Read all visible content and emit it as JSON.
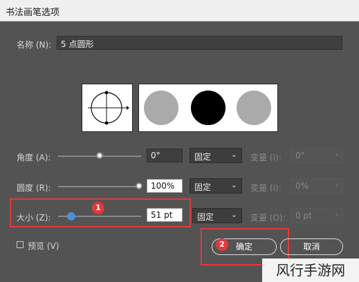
{
  "window": {
    "title": "书法画笔选项"
  },
  "name_row": {
    "label": "名称 (N):",
    "value": "5 点圆形"
  },
  "angle": {
    "label": "角度 (A):",
    "value": "0°",
    "mode": "固定",
    "variation_label": "变量 (I):",
    "variation_value": "0°"
  },
  "roundness": {
    "label": "圆度 (R):",
    "value": "100%",
    "mode": "固定",
    "variation_label": "变量 (I):",
    "variation_value": "0%"
  },
  "size": {
    "label": "大小 (Z):",
    "value": "51 pt",
    "mode": "固定",
    "variation_label": "变量 (O):",
    "variation_value": "0 pt",
    "level": 0.16
  },
  "preview": {
    "label": "预览 (V)"
  },
  "buttons": {
    "ok": "确定",
    "cancel": "取消"
  },
  "badges": {
    "one": "1",
    "two": "2"
  },
  "watermark": "风行手游网",
  "colors": {
    "accent": "#e23a3a",
    "knob_blue": "#4a90d9",
    "dialog_bg": "#535353"
  }
}
